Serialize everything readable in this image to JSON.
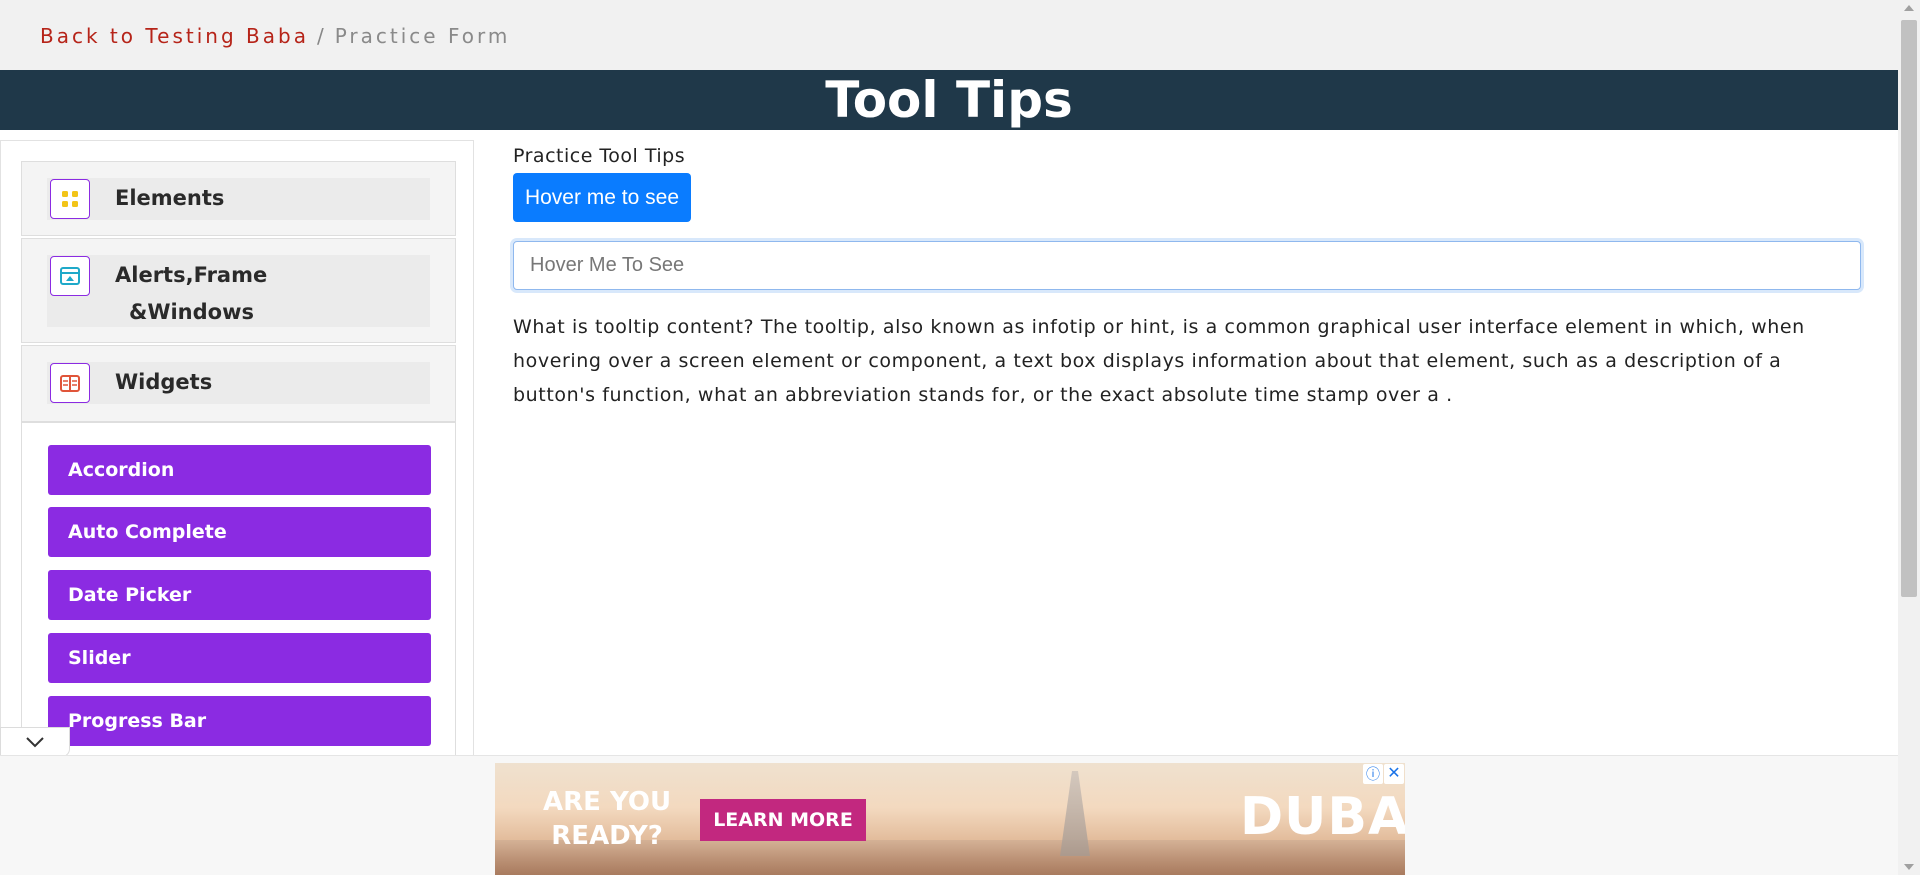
{
  "breadcrumb": {
    "back_label": "Back to Testing Baba",
    "separator": "/",
    "current": "Practice Form"
  },
  "banner": {
    "title": "Tool Tips"
  },
  "sidebar": {
    "groups": [
      {
        "label": "Elements",
        "icon": "elements-grid-icon"
      },
      {
        "label_line1": "Alerts,Frame",
        "label_line2": "&Windows",
        "icon": "browser-window-icon"
      },
      {
        "label": "Widgets",
        "icon": "widgets-icon"
      }
    ],
    "menu_items": [
      {
        "label": "Accordion"
      },
      {
        "label": "Auto Complete"
      },
      {
        "label": "Date Picker"
      },
      {
        "label": "Slider"
      },
      {
        "label": "Progress Bar"
      }
    ]
  },
  "main": {
    "section_label": "Practice Tool Tips",
    "hover_button_label": "Hover me to see",
    "hover_input_placeholder": "Hover Me To See",
    "description": "What is tooltip content? The tooltip, also known as infotip or hint, is a common graphical user interface element in which, when hovering over a screen element or component, a text box displays information about that element, such as a description of a button's function, what an abbreviation stands for, or the exact absolute time stamp over a ."
  },
  "ad": {
    "headline_line1": "ARE YOU",
    "headline_line2": "READY?",
    "cta_label": "LEARN MORE",
    "brand": "DUBAI",
    "info_icon": "ⓘ",
    "close_icon": "✕"
  },
  "colors": {
    "banner_bg": "#1f3849",
    "menu_purple": "#8b2be2",
    "primary_button": "#0a7cff",
    "breadcrumb_link": "#b62419"
  }
}
